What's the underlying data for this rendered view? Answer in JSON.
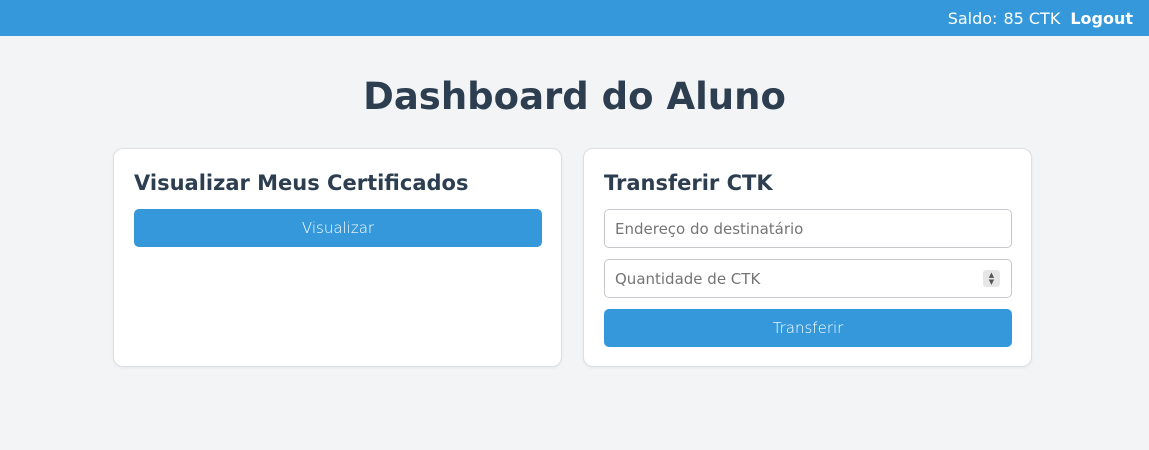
{
  "topbar": {
    "balance_label": "Saldo:",
    "balance_value": "85 CTK",
    "logout_label": "Logout",
    "background_color": "#3498db"
  },
  "page": {
    "title": "Dashboard do Aluno"
  },
  "certificates_card": {
    "title": "Visualizar Meus Certificados",
    "button_label": "Visualizar"
  },
  "transfer_card": {
    "title": "Transferir CTK",
    "address_placeholder": "Endereço do destinatário",
    "address_value": "",
    "amount_placeholder": "Quantidade de CTK",
    "amount_value": "",
    "button_label": "Transferir"
  },
  "colors": {
    "accent": "#3498db",
    "title_text": "#2c3e50",
    "page_background": "#f3f4f6"
  }
}
